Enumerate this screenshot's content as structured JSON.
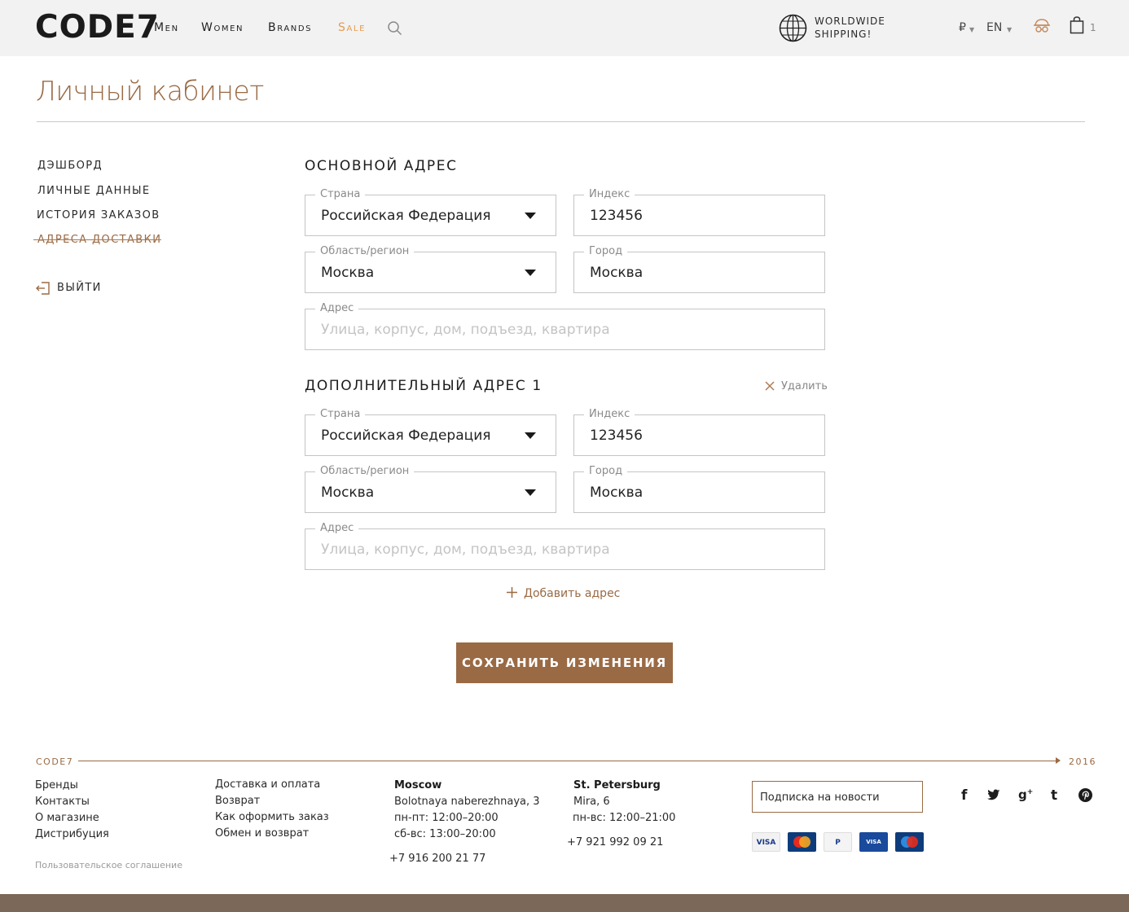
{
  "header": {
    "logo": "CODE7",
    "nav": [
      "Men",
      "Women",
      "Brands",
      "Sale"
    ],
    "shipping_line1": "WORLDWIDE",
    "shipping_line2": "SHIPPING!",
    "currency": "₽",
    "language": "EN",
    "cart_count": "1"
  },
  "page": {
    "title": "Личный кабинет"
  },
  "sidebar": {
    "items": [
      {
        "label": "ДЭШБОРД"
      },
      {
        "label": "ЛИЧНЫЕ ДАННЫЕ"
      },
      {
        "label": "ИСТОРИЯ ЗАКАЗОВ"
      },
      {
        "label": "АДРЕСА ДОСТАВКИ"
      }
    ],
    "logout": "ВЫЙТИ"
  },
  "primary": {
    "title": "ОСНОВНОЙ АДРЕС",
    "country_label": "Страна",
    "country": "Российская Федерация",
    "zip_label": "Индекс",
    "zip": "123456",
    "region_label": "Область/регион",
    "region": "Москва",
    "city_label": "Город",
    "city": "Москва",
    "address_label": "Адрес",
    "address_placeholder": "Улица, корпус, дом, подъезд, квартира"
  },
  "extra": {
    "title": "ДОПОЛНИТЕЛЬНЫЙ АДРЕС 1",
    "remove": "Удалить",
    "country_label": "Страна",
    "country": "Российская Федерация",
    "zip_label": "Индекс",
    "zip": "123456",
    "region_label": "Область/регион",
    "region": "Москва",
    "city_label": "Город",
    "city": "Москва",
    "address_label": "Адрес",
    "address_placeholder": "Улица, корпус, дом, подъезд, квартира"
  },
  "add_address": "Добавить адрес",
  "save_button": "СОХРАНИТЬ ИЗМЕНЕНИЯ",
  "footer": {
    "brand": "CODE7",
    "year": "2016",
    "col1": [
      "Бренды",
      "Контакты",
      "О магазине",
      "Дистрибуция"
    ],
    "col2": [
      "Доставка и оплата",
      "Возврат",
      "Как оформить заказ",
      "Обмен и возврат"
    ],
    "moscow": {
      "city": "Moscow",
      "address": "Bolotnaya naberezhnaya, 3",
      "hours1": "пн-пт: 12:00–20:00",
      "hours2": "сб-вс: 13:00–20:00",
      "phone": "+7 916 200 21 77"
    },
    "spb": {
      "city": "St. Petersburg",
      "address": "Mira, 6",
      "hours1": "пн-вс: 12:00–21:00",
      "phone": "+7 921 992 09 21"
    },
    "subscribe": "Подписка на новости",
    "agreement": "Пользовательское соглашение",
    "payments": [
      "VISA",
      "MasterCard",
      "PayPal",
      "VISA Electron",
      "Maestro"
    ]
  },
  "colors": {
    "accent": "#9a6a44",
    "sale": "#e49b52",
    "header_bg": "#f2f2f2",
    "bottom_bar": "#7b6858"
  }
}
